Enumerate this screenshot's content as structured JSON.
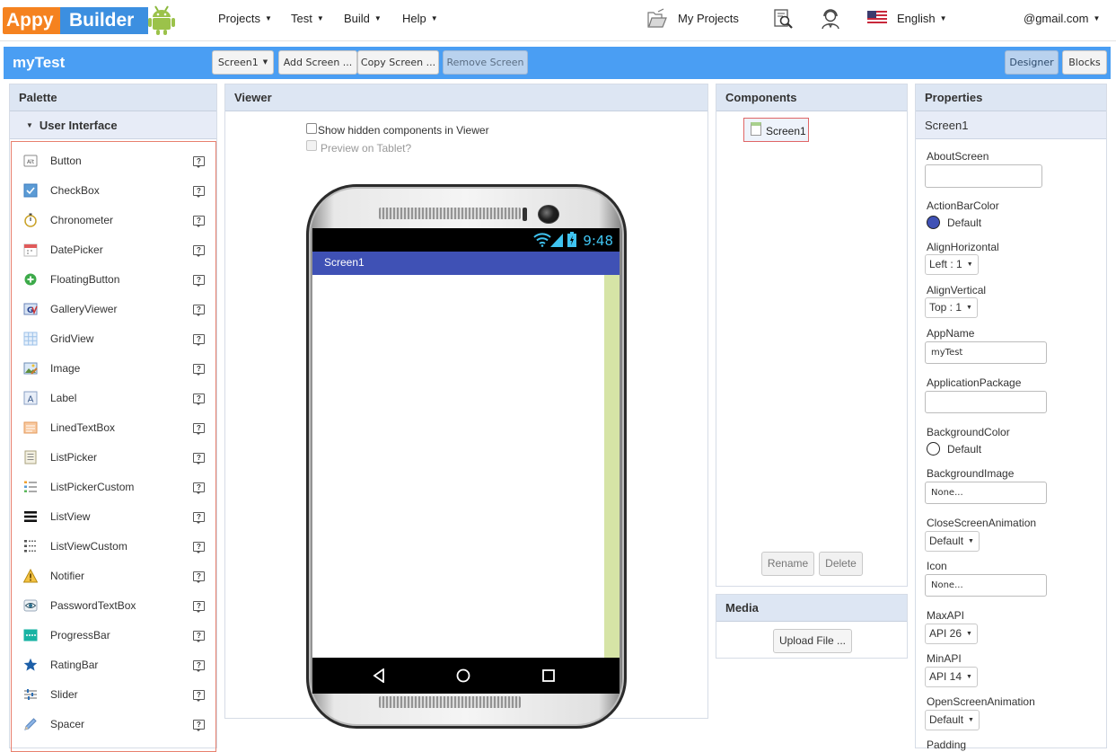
{
  "nav": {
    "logo_word1": "Appy",
    "logo_word2": "Builder",
    "menus": [
      "Projects",
      "Test",
      "Build",
      "Help"
    ],
    "my_projects": "My Projects",
    "language": "English",
    "account": "@gmail.com",
    "icons": [
      "folder-open-icon",
      "search-document-icon",
      "user-support-icon",
      "us-flag-icon"
    ]
  },
  "toolbar": {
    "project_name": "myTest",
    "screen_select": "Screen1",
    "add_screen": "Add Screen ...",
    "copy_screen": "Copy Screen ...",
    "remove_screen": "Remove Screen",
    "designer": "Designer",
    "blocks": "Blocks"
  },
  "palette": {
    "title": "Palette",
    "category": "User Interface",
    "items": [
      {
        "label": "Button",
        "icon": "button-icon"
      },
      {
        "label": "CheckBox",
        "icon": "checkbox-icon"
      },
      {
        "label": "Chronometer",
        "icon": "stopwatch-icon"
      },
      {
        "label": "DatePicker",
        "icon": "calendar-icon"
      },
      {
        "label": "FloatingButton",
        "icon": "plus-circle-icon"
      },
      {
        "label": "GalleryViewer",
        "icon": "gallery-icon"
      },
      {
        "label": "GridView",
        "icon": "grid-icon"
      },
      {
        "label": "Image",
        "icon": "image-icon"
      },
      {
        "label": "Label",
        "icon": "label-icon"
      },
      {
        "label": "LinedTextBox",
        "icon": "lined-textbox-icon"
      },
      {
        "label": "ListPicker",
        "icon": "list-picker-icon"
      },
      {
        "label": "ListPickerCustom",
        "icon": "list-picker-custom-icon"
      },
      {
        "label": "ListView",
        "icon": "list-view-icon"
      },
      {
        "label": "ListViewCustom",
        "icon": "list-view-custom-icon"
      },
      {
        "label": "Notifier",
        "icon": "warning-icon"
      },
      {
        "label": "PasswordTextBox",
        "icon": "eye-icon"
      },
      {
        "label": "ProgressBar",
        "icon": "progress-bar-icon"
      },
      {
        "label": "RatingBar",
        "icon": "star-icon"
      },
      {
        "label": "Slider",
        "icon": "slider-icon"
      },
      {
        "label": "Spacer",
        "icon": "pencil-icon"
      }
    ],
    "help_glyph": "?"
  },
  "viewer": {
    "title": "Viewer",
    "show_hidden": "Show hidden components in Viewer",
    "preview_tablet": "Preview on Tablet?",
    "phone": {
      "clock": "9:48",
      "screen_title": "Screen1"
    }
  },
  "components": {
    "title": "Components",
    "tree_root": "Screen1",
    "rename": "Rename",
    "delete": "Delete"
  },
  "media": {
    "title": "Media",
    "upload": "Upload File ..."
  },
  "properties": {
    "title": "Properties",
    "component": "Screen1",
    "about_screen_label": "AboutScreen",
    "about_screen_value": "",
    "action_bar_color_label": "ActionBarColor",
    "action_bar_color_value": "Default",
    "action_bar_color_hex": "#3f51b5",
    "align_h_label": "AlignHorizontal",
    "align_h_value": "Left : 1",
    "align_v_label": "AlignVertical",
    "align_v_value": "Top : 1",
    "app_name_label": "AppName",
    "app_name_value": "myTest",
    "app_package_label": "ApplicationPackage",
    "app_package_value": "",
    "bg_color_label": "BackgroundColor",
    "bg_color_value": "Default",
    "bg_color_hex": "#ffffff",
    "bg_image_label": "BackgroundImage",
    "bg_image_value": "None...",
    "close_anim_label": "CloseScreenAnimation",
    "close_anim_value": "Default",
    "icon_label": "Icon",
    "icon_value": "None...",
    "max_api_label": "MaxAPI",
    "max_api_value": "API 26",
    "min_api_label": "MinAPI",
    "min_api_value": "API 14",
    "open_anim_label": "OpenScreenAnimation",
    "open_anim_value": "Default",
    "next_label_partial": "Padding"
  }
}
